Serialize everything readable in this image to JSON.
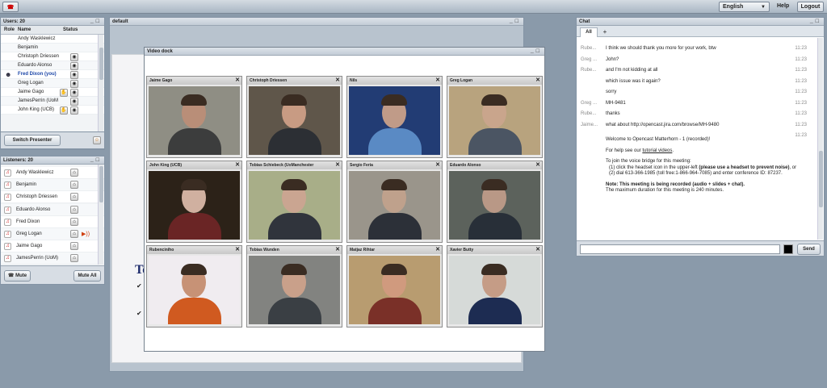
{
  "topbar": {
    "language": "English",
    "help": "Help",
    "logout": "Logout"
  },
  "users": {
    "title": "Users: 20",
    "cols": {
      "role": "Role",
      "name": "Name",
      "status": "Status"
    },
    "rows": [
      {
        "name": "Andy Wasklewicz"
      },
      {
        "name": "Benjamin"
      },
      {
        "name": "Christoph Driessen"
      },
      {
        "name": "Eduardo Alonso"
      },
      {
        "name": "Fred Dixon (you)"
      },
      {
        "name": "Greg Logan"
      },
      {
        "name": "Jaime Gago"
      },
      {
        "name": "JamesPerrin (UoM"
      },
      {
        "name": "John King (UCB)"
      }
    ],
    "switch_presenter": "Switch Presenter"
  },
  "listeners": {
    "title": "Listeners: 20",
    "rows": [
      {
        "name": "Andy Wasklewicz"
      },
      {
        "name": "Benjamin"
      },
      {
        "name": "Christoph Driessen"
      },
      {
        "name": "Eduardo Alonso"
      },
      {
        "name": "Fred Dixon"
      },
      {
        "name": "Greg Logan"
      },
      {
        "name": "Jaime Gago"
      },
      {
        "name": "JamesPerrin (UoM)"
      }
    ],
    "mute": "Mute",
    "mute_all": "Mute All"
  },
  "presentation": {
    "title": "default",
    "slide_letter": "Te"
  },
  "video_dock": {
    "title": "Video dock",
    "tiles": [
      {
        "name": "Jaime Gago",
        "bg": "#8f8e84",
        "shirt": "#3c3d3d",
        "skin": "#b98e78"
      },
      {
        "name": "Christoph Driessen",
        "bg": "#5f564a",
        "shirt": "#2c2f34",
        "skin": "#c89b83"
      },
      {
        "name": "Nils",
        "bg": "#223c74",
        "shirt": "#5a8ac4",
        "skin": "#c09b88"
      },
      {
        "name": "Greg Logan",
        "bg": "#b8a37e",
        "shirt": "#4b5563",
        "skin": "#c9a58c"
      },
      {
        "name": "John King (UCB)",
        "bg": "#2c2218",
        "shirt": "#6a2525",
        "skin": "#d0b0a0"
      },
      {
        "name": "Tobias Schiebeck (UoManchester",
        "bg": "#a8ae88",
        "shirt": "#30343c",
        "skin": "#caa591"
      },
      {
        "name": "Sergio Feria",
        "bg": "#9a958b",
        "shirt": "#2c3038",
        "skin": "#bfa18c"
      },
      {
        "name": "Eduardo Alonso",
        "bg": "#5c625c",
        "shirt": "#282f38",
        "skin": "#b99886"
      },
      {
        "name": "Rubenciniho",
        "bg": "#f0ecf0",
        "shirt": "#d05a20",
        "skin": "#c79276"
      },
      {
        "name": "Tobias Wunden",
        "bg": "#828380",
        "shirt": "#3a3f44",
        "skin": "#c9a08a"
      },
      {
        "name": "Matjaz Rihtar",
        "bg": "#b89c70",
        "shirt": "#7a3028",
        "skin": "#d09a7e"
      },
      {
        "name": "Xavier Butty",
        "bg": "#d6dad8",
        "shirt": "#1d2c52",
        "skin": "#c59c86"
      }
    ]
  },
  "chat": {
    "title": "Chat",
    "tabs": {
      "all": "All",
      "add": "+"
    },
    "send": "Send",
    "input_value": "",
    "messages": [
      {
        "name": "Rube...",
        "text": "I think we should thank you more for your work, btw",
        "time": "11:23"
      },
      {
        "name": "Greg ...",
        "text": "John?",
        "time": "11:23"
      },
      {
        "name": "Rube...",
        "text": "and I'm not kidding at all",
        "time": "11:23"
      },
      {
        "name": "",
        "text": "which issue was it again?",
        "time": "11:23"
      },
      {
        "name": "",
        "text": "sorry",
        "time": "11:23"
      },
      {
        "name": "Greg ...",
        "text": "MH-9481",
        "time": "11:23"
      },
      {
        "name": "Rube...",
        "text": "thanks",
        "time": "11:23"
      },
      {
        "name": "Jaime...",
        "text": "what about  http://opencast.jira.com/browse/MH-9480",
        "time": "11:23"
      },
      {
        "name": "",
        "text": "",
        "time": "11:23"
      }
    ],
    "system": {
      "welcome": "Welcome to Opencast Matterhorn - 1 (recorded)!",
      "help_prefix": "For help see our ",
      "help_link": "tutorial videos",
      "help_suffix": ".",
      "join": "To join the voice bridge for this meeting:",
      "step1_prefix": "(1) click the headset icon in the upper-left ",
      "step1_bold": "(please use a headset to prevent noise)",
      "step1_suffix": ", or",
      "step2": "(2) dial 613-366-1985 (toll free:1-866-964-7085) and enter conference ID: 87237.",
      "note": "Note: This meeting is being recorded (audio + slides + chat).",
      "duration": "The maximum duration for this meeting is 240 minutes."
    }
  }
}
